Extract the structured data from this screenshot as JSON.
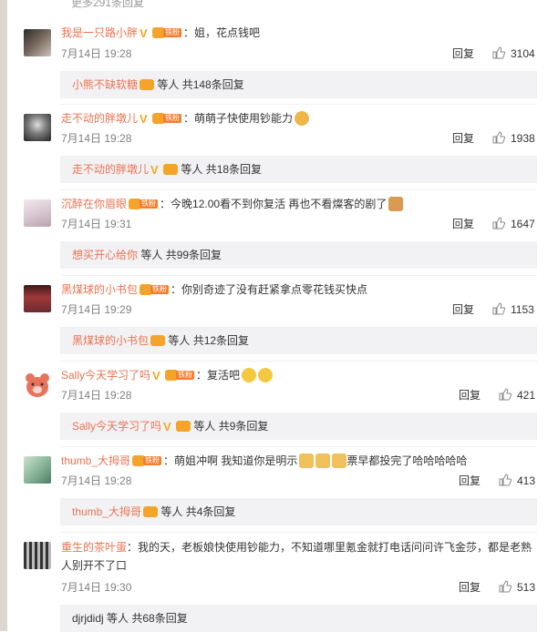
{
  "top_partial": "更多291条回复",
  "comments": [
    {
      "user": "我是一只路小胖",
      "verified": true,
      "fan_badge": "铁粉",
      "text": "：姐，花点钱吧",
      "time": "7月14日 19:28",
      "reply_label": "回复",
      "likes": "3104",
      "sub_user": "小熊不缺软糖",
      "sub_text": "等人 共148条回复"
    },
    {
      "user": "走不动的胖墩儿",
      "verified": true,
      "fan_badge": "铁粉",
      "text": "：萌萌子快使用钞能力",
      "time": "7月14日 19:28",
      "reply_label": "回复",
      "likes": "1938",
      "sub_user": "走不动的胖墩儿",
      "sub_text": "等人 共18条回复"
    },
    {
      "user": "沉醉在你眉眼",
      "verified": false,
      "fan_badge": "铁粉",
      "text": "：今晚12.00看不到你复活 再也不看燦客的剧了",
      "time": "7月14日 19:31",
      "reply_label": "回复",
      "likes": "1647",
      "sub_user": "想买开心给你",
      "sub_text": "等人 共99条回复"
    },
    {
      "user": "黑煤球的小书包",
      "verified": false,
      "fan_badge": "铁粉",
      "text": "：你别奇迹了没有赶紧拿点零花钱买快点",
      "time": "7月14日 19:29",
      "reply_label": "回复",
      "likes": "1153",
      "sub_user": "黑煤球的小书包",
      "sub_text": "等人 共12条回复"
    },
    {
      "user": "Sally今天学习了吗",
      "verified": true,
      "fan_badge": "铁粉",
      "text": "：复活吧",
      "time": "7月14日 19:28",
      "reply_label": "回复",
      "likes": "421",
      "sub_user": "Sally今天学习了吗",
      "sub_text": "等人 共9条回复"
    },
    {
      "user": "thumb_大拇哥",
      "verified": false,
      "fan_badge": "铁粉",
      "text": "：萌姐冲啊 我知道你是明示",
      "text2": "票早都投完了哈哈哈哈哈",
      "time": "7月14日 19:28",
      "reply_label": "回复",
      "likes": "413",
      "sub_user": "thumb_大拇哥",
      "sub_text": "等人 共4条回复"
    },
    {
      "user": "重生的茶叶蛋",
      "verified": false,
      "fan_badge": "",
      "text": "：我的天，老板娘快使用钞能力，不知道哪里氪金就打电话问问许飞金莎，都是老熟人别开不了口",
      "time": "7月14日 19:30",
      "reply_label": "回复",
      "likes": "513",
      "sub_user": "",
      "sub_text": "djrjdidj 等人 共68条回复"
    }
  ],
  "colors": {
    "username": "#eb7350",
    "time": "#808080",
    "sub_bg": "#f2f2f5"
  }
}
